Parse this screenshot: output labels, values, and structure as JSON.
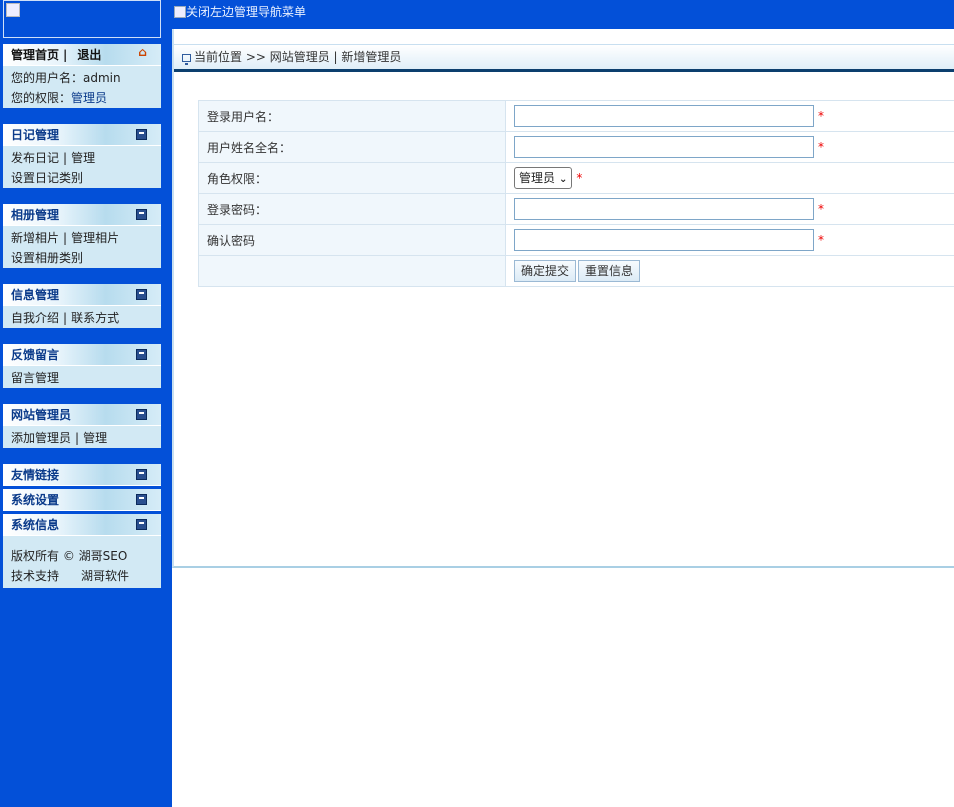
{
  "toggle": {
    "alt": "关闭左边管理导航菜单"
  },
  "sidebar": {
    "home": {
      "home_label": "管理首页",
      "bar": "|",
      "logout_label": "退出",
      "username_line": "您的用户名：admin",
      "role_label": "您的权限：",
      "role_value": "管理员"
    },
    "diary": {
      "title": "日记管理",
      "publish": "发布日记",
      "manage": "管理",
      "category": "设置日记类别"
    },
    "album": {
      "title": "相册管理",
      "add": "新增相片",
      "manage": "管理相片",
      "category": "设置相册类别"
    },
    "info": {
      "title": "信息管理",
      "intro": "自我介绍",
      "contact": "联系方式"
    },
    "feedback": {
      "title": "反馈留言",
      "manage": "留言管理"
    },
    "admins": {
      "title": "网站管理员",
      "add": "添加管理员",
      "manage": "管理"
    },
    "links": {
      "title": "友情链接"
    },
    "settings": {
      "title": "系统设置"
    },
    "sysinfo": {
      "title": "系统信息",
      "copyright": "版权所有 ©  湖哥SEO",
      "support_label": "技术支持",
      "support_value": "湖哥软件"
    },
    "separator": "|"
  },
  "breadcrumb": {
    "text": "当前位置 >> 网站管理员 | 新增管理员"
  },
  "form": {
    "login_label": "登录用户名：",
    "fullname_label": "用户姓名全名：",
    "role_label": "角色权限：",
    "role_value": "管理员",
    "password_label": "登录密码：",
    "confirm_label": "确认密码",
    "required_mark": "*",
    "submit_label": "确定提交",
    "reset_label": "重置信息"
  }
}
